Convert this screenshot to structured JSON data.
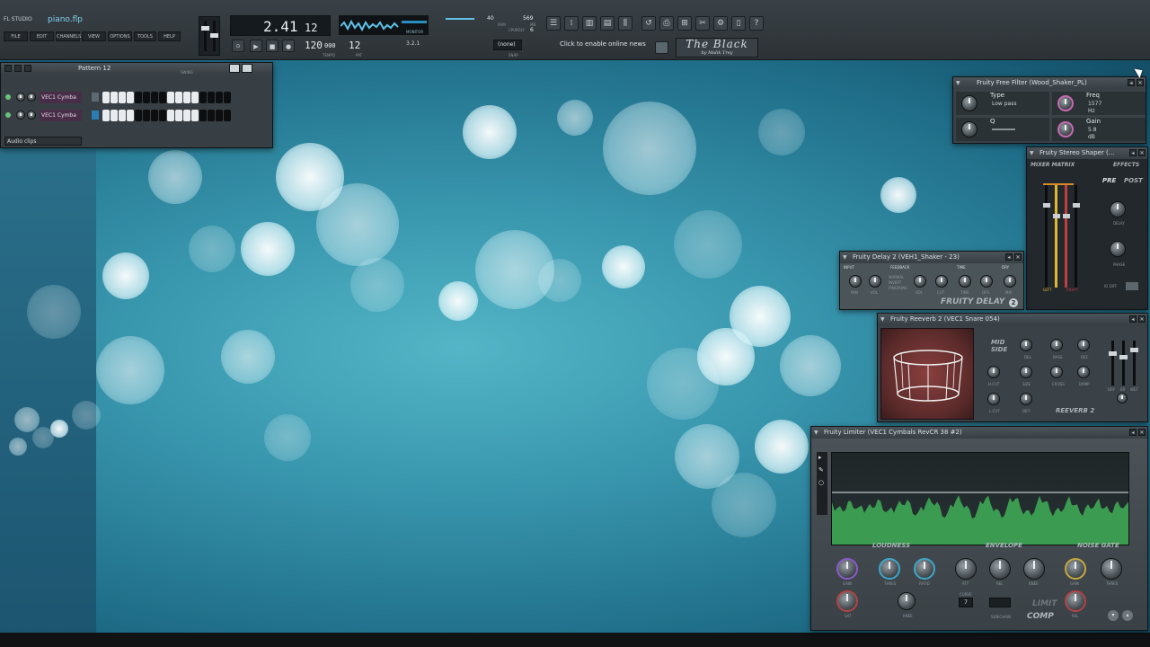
{
  "app": {
    "logo": "FL STUDIO",
    "filename": "piano.flp"
  },
  "menu": [
    "FILE",
    "EDIT",
    "CHANNELS",
    "VIEW",
    "OPTIONS",
    "TOOLS",
    "HELP"
  ],
  "transport": {
    "song_position": "2.41",
    "song_position_ticks": "12",
    "tempo": "120",
    "tempo_decimal": "000",
    "tempo_label": "TEMPO",
    "pattern": "12",
    "pattern_label": "PAT",
    "monitor_label": "MONITOR",
    "ram_value": "40",
    "ram_label": "RAM",
    "mb_value": "569",
    "mb_label": "MB",
    "cpu_label": "CPU",
    "poly_label": "POLY",
    "poly_value": "6",
    "snap_value": "(none)",
    "snap_label": "SNAP",
    "counter": "3.2.1"
  },
  "news": {
    "hint": "Click to enable online news"
  },
  "brand": {
    "title": "The Black",
    "subtitle": "by Malik Trey"
  },
  "pattern_window": {
    "title": "Pattern 12",
    "swing_label": "SWING",
    "channels": [
      {
        "name": "VEC1 Cymba",
        "steps": [
          1,
          1,
          1,
          1,
          0,
          0,
          0,
          0,
          1,
          1,
          1,
          1,
          0,
          0,
          0,
          0
        ]
      },
      {
        "name": "VEC1 Cymba",
        "steps": [
          1,
          1,
          1,
          1,
          0,
          0,
          0,
          0,
          1,
          1,
          1,
          1,
          0,
          0,
          0,
          0
        ]
      }
    ],
    "filter": "Audio clips"
  },
  "free_filter": {
    "title": "Fruity Free Filter (Wood_Shaker_PL)",
    "type_label": "Type",
    "type_value": "Low pass",
    "freq_label": "Freq",
    "freq_value": "1577",
    "freq_unit": "Hz",
    "q_label": "Q",
    "gain_label": "Gain",
    "gain_value": "5.8",
    "gain_unit": "dB"
  },
  "stereo_shaper": {
    "title": "Fruity Stereo Shaper (...",
    "mixer_label": "MIXER MATRIX",
    "effects_label": "EFFECTS",
    "pre_label": "PRE",
    "post_label": "POST",
    "delay_label": "DELAY",
    "phase_label": "PHASE",
    "left_label": "LEFT",
    "right_label": "RIGHT",
    "io_label": "IO DIFF"
  },
  "delay2": {
    "title": "Fruity Delay 2 (VEH1_Shaker - 23)",
    "sections": [
      "INPUT",
      "FEEDBACK",
      "TIME",
      "DRY"
    ],
    "knobs": [
      "PAN",
      "VOL",
      "VOL",
      "CUT",
      "TIME",
      "OFS",
      "MIX"
    ],
    "modes": [
      "NORMAL",
      "INVERT",
      "PINGPONG"
    ],
    "logo": "FRUITY DELAY",
    "logo_num": "2"
  },
  "reeverb2": {
    "title": "Fruity Reeverb 2 (VEC1 Snare 054)",
    "mode": "MID SIDE",
    "knobs_top": [
      "DEL",
      "BASS",
      "DEC"
    ],
    "knobs_mid": [
      "H.CUT",
      "SIZE",
      "CROSS",
      "DAMP"
    ],
    "knobs_bot": [
      "L.CUT",
      "DIFF"
    ],
    "faders": [
      "DRY",
      "ER",
      "WET"
    ],
    "logo": "REEVERB 2"
  },
  "limiter": {
    "title": "Fruity Limiter (VEC1 Cymbals RevCR 38 #2)",
    "sections": [
      "LOUDNESS",
      "ENVELOPE",
      "NOISE GATE"
    ],
    "knobs_row1": [
      "GAIN",
      "THRES",
      "RATIO",
      "ATT",
      "REL",
      "KNEE",
      "GAIN",
      "THRES"
    ],
    "knobs_row2": [
      "SAT",
      "KNEE",
      "CURVE",
      "SIDECHAIN",
      "REL"
    ],
    "curve_value": "7",
    "mode_limit": "LIMIT",
    "mode_comp": "COMP"
  },
  "colors": {
    "accent": "#7fd2ef",
    "background_main": "#3896ad",
    "window": "#3c4449",
    "lcd_text": "#e8eef2",
    "waveform": "#3faf57"
  }
}
